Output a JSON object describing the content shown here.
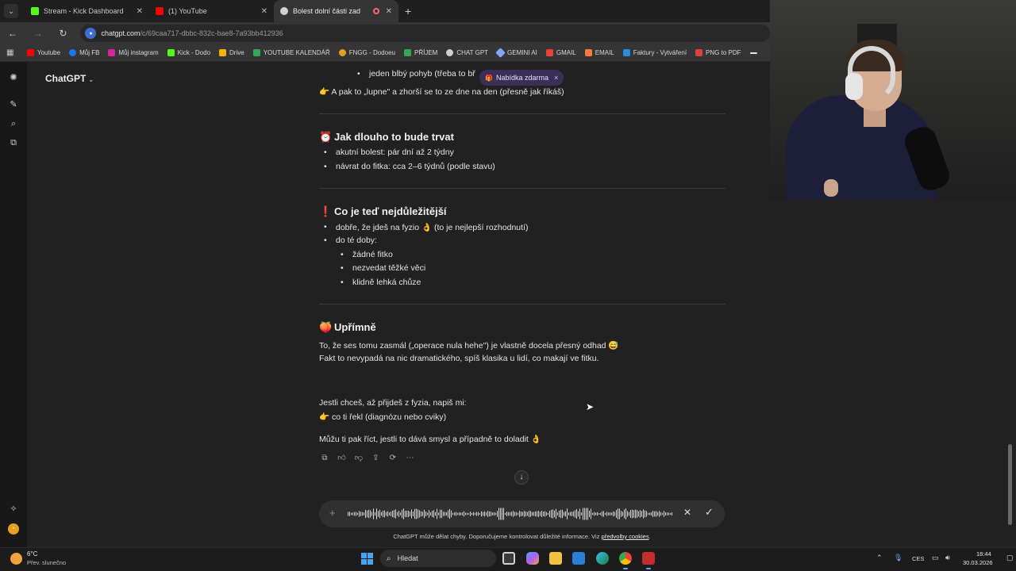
{
  "browser": {
    "tabs": [
      {
        "label": "Stream - Kick Dashboard",
        "icon": "kick-icon",
        "color": "#53fc18"
      },
      {
        "label": "(1) YouTube",
        "icon": "youtube-icon",
        "color": "#ff0000"
      },
      {
        "label": "Bolest dolní části zad",
        "icon": "chatgpt-icon",
        "color": "#d0d0d0",
        "active": true
      }
    ],
    "url_host": "chatgpt.com",
    "url_path": "/c/69caa717-dbbc-832c-bae8-7a93bb412936",
    "bookmarks": [
      {
        "label": "Youtube",
        "color": "#ff0000"
      },
      {
        "label": "Můj FB",
        "color": "#1877f2"
      },
      {
        "label": "Můj instagram",
        "color": "#d6249f"
      },
      {
        "label": "Kick - Dodo",
        "color": "#53fc18"
      },
      {
        "label": "Drive",
        "color": "#f4b400"
      },
      {
        "label": "YOUTUBE KALENDÁŘ",
        "color": "#34a853"
      },
      {
        "label": "FNGG - Dodoeu",
        "color": "#e0a020"
      },
      {
        "label": "PŘÍJEM",
        "color": "#34a853"
      },
      {
        "label": "CHAT GPT",
        "color": "#d0d0d0"
      },
      {
        "label": "GEMINI AI",
        "color": "#7fa7ff"
      },
      {
        "label": "GMAIL",
        "color": "#ea4335"
      },
      {
        "label": "EMAIL",
        "color": "#ff7a3a"
      },
      {
        "label": "Faktury - Vytváření",
        "color": "#2c8ad8"
      },
      {
        "label": "PNG to PDF",
        "color": "#e0403a"
      }
    ]
  },
  "app": {
    "brand": "ChatGPT",
    "promo_pill": "Nabídka zdarma",
    "promo_close": "×"
  },
  "conversation": {
    "partial_bullet": "jeden blbý pohyb (třeba to bř",
    "intro_line": "👉 A pak to „lupne\" a zhorší se to ze dne na den (přesně jak říkáš)",
    "sections": {
      "duration": {
        "emoji": "⏰",
        "title": "Jak dlouho to bude trvat",
        "items": [
          "akutní bolest: pár dní až 2 týdny",
          "návrat do fitka: cca 2–6 týdnů (podle stavu)"
        ]
      },
      "important": {
        "emoji": "❗",
        "title": "Co je teď nejdůležitější",
        "items": [
          "dobře, že jdeš na fyzio 👌 (to je nejlepší rozhodnutí)",
          "do té doby:"
        ],
        "subitems": [
          "žádné fitko",
          "nezvedat těžké věci",
          "klidně lehká chůze"
        ]
      },
      "honestly": {
        "emoji": "🍑",
        "title": "Upřímně",
        "lines": [
          "To, že ses tomu zasmál („operace nula hehe\") je vlastně docela přesný odhad 😅",
          "Fakt to nevypadá na nic dramatického, spíš klasika u lidí, co makají ve fitku."
        ]
      }
    },
    "followup": [
      "Jestli chceš, až přijdeš z fyzia, napiš mi:",
      "👉 co ti řekl (diagnózu nebo cviky)"
    ],
    "closing": "Můžu ti pak říct, jestli to dává smysl a případně to doladit 👌"
  },
  "composer": {
    "plus": "+",
    "cancel": "✕",
    "confirm": "✓"
  },
  "disclaimer": {
    "text": "ChatGPT může dělat chyby. Doporučujeme kontrolovat důležité informace. Viz",
    "link": "předvolby cookies",
    "tail": "."
  },
  "taskbar": {
    "temperature": "6°C",
    "weather": "Přev. slunečno",
    "search": "Hledat",
    "language": "CES",
    "time": "18:44",
    "date": "30.03.2026"
  }
}
